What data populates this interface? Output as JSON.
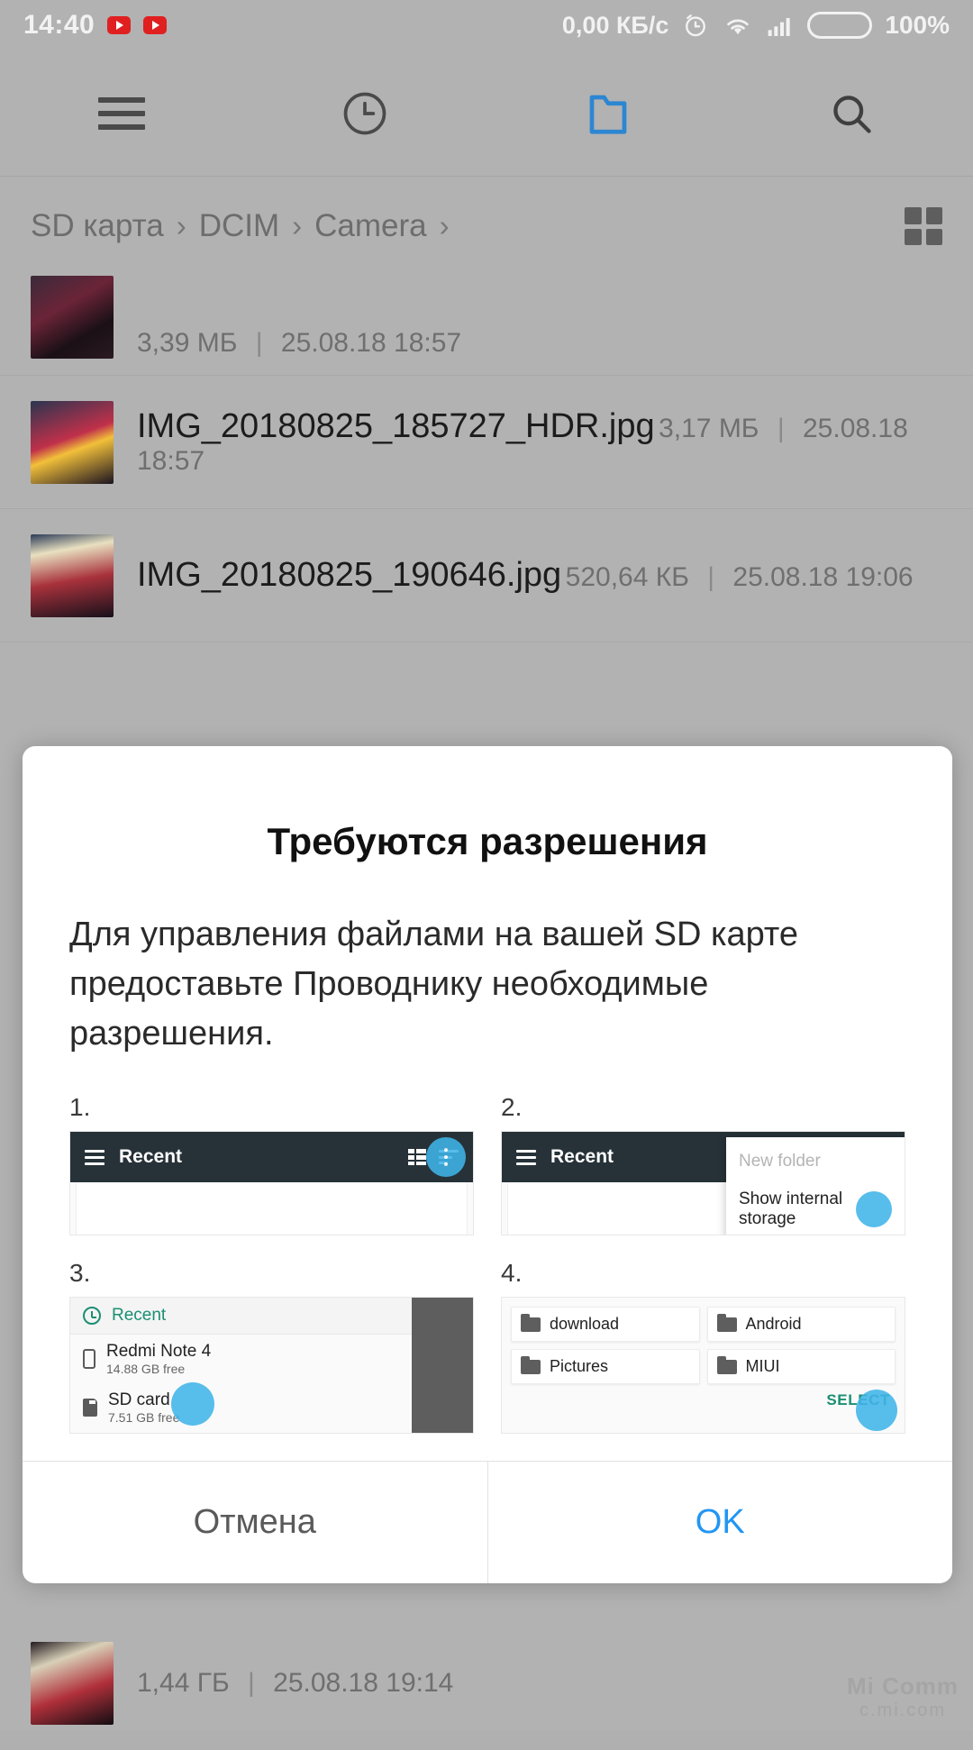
{
  "statusbar": {
    "time": "14:40",
    "youtube_icon": "youtube-icon",
    "network_speed": "0,00 КБ/с",
    "alarm_icon": "alarm-icon",
    "wifi_icon": "wifi-icon",
    "signal_icon": "signal-icon",
    "battery_percent": "100%",
    "battery_color": "#f5a623"
  },
  "toolbar": {
    "menu_icon": "hamburger-menu-icon",
    "recent_icon": "clock-recent-icon",
    "folder_icon": "folder-icon",
    "search_icon": "search-icon",
    "active_color": "#2d86d1"
  },
  "breadcrumb": {
    "crumbs": [
      "SD карта",
      "DCIM",
      "Camera"
    ],
    "separator": "›",
    "grid_toggle_icon": "grid-view-icon"
  },
  "files": [
    {
      "name": "",
      "size": "3,39 МБ",
      "date": "25.08.18 18:57",
      "clipped": true
    },
    {
      "name": "IMG_20180825_185727_HDR.jpg",
      "size": "3,17 МБ",
      "date": "25.08.18 18:57",
      "clipped": false
    },
    {
      "name": "IMG_20180825_190646.jpg",
      "size": "520,64 КБ",
      "date": "25.08.18 19:06",
      "clipped": false
    },
    {
      "name": "",
      "size": "1,44 ГБ",
      "date": "25.08.18 19:14",
      "clipped": true
    }
  ],
  "dialog": {
    "title": "Требуются разрешения",
    "body": "Для управления файлами на вашей SD карте предоставьте Проводнику необходимые разрешения.",
    "cancel_label": "Отмена",
    "ok_label": "OK",
    "ok_color": "#2196f3",
    "steps": [
      {
        "number": "1.",
        "toolbar_title": "Recent",
        "menu_icon": "hamburger-menu-icon",
        "listview_icon": "list-view-icon",
        "sort_icon": "sort-icon",
        "overflow_icon": "overflow-menu-icon",
        "tap_hint": "tap-indicator"
      },
      {
        "number": "2.",
        "toolbar_title": "Recent",
        "menu_items": [
          "New folder",
          "Show internal storage"
        ],
        "disabled_item": "New folder",
        "tap_hint": "tap-indicator"
      },
      {
        "number": "3.",
        "recent_label": "Recent",
        "storage": [
          {
            "title": "Redmi Note 4",
            "subtitle": "14.88 GB free",
            "icon": "phone-icon"
          },
          {
            "title": "SD card",
            "subtitle": "7.51 GB free",
            "icon": "sd-card-icon"
          }
        ],
        "tap_hint": "tap-indicator"
      },
      {
        "number": "4.",
        "folders": [
          "download",
          "Android",
          "Pictures",
          "MIUI"
        ],
        "select_label": "SELECT",
        "select_color": "#1b8f72",
        "tap_hint": "tap-indicator"
      }
    ]
  },
  "watermark": {
    "line1": "Mi Comm",
    "line2": "c.mi.com"
  }
}
